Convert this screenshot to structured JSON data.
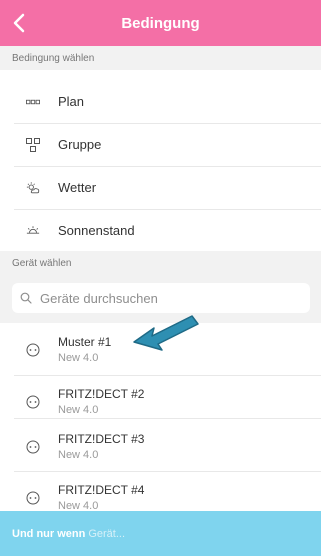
{
  "header": {
    "title": "Bedingung",
    "back_icon": "chevron-left-icon"
  },
  "sections": {
    "condition": "Bedingung wählen",
    "device": "Gerät wählen"
  },
  "conditions": [
    {
      "label": "Plan",
      "icon": "plan-icon"
    },
    {
      "label": "Gruppe",
      "icon": "group-icon"
    },
    {
      "label": "Wetter",
      "icon": "weather-icon"
    },
    {
      "label": "Sonnenstand",
      "icon": "sun-icon"
    }
  ],
  "search": {
    "placeholder": "Geräte durchsuchen",
    "value": ""
  },
  "devices": [
    {
      "name": "Muster #1",
      "sub": "New 4.0"
    },
    {
      "name": "FRITZ!DECT #2",
      "sub": "New 4.0"
    },
    {
      "name": "FRITZ!DECT #3",
      "sub": "New 4.0"
    },
    {
      "name": "FRITZ!DECT #4",
      "sub": "New 4.0"
    }
  ],
  "footer": {
    "bold": "Und nur wenn",
    "light": "Gerät..."
  },
  "colors": {
    "header": "#f46fa6",
    "footer": "#7fd4ee",
    "arrow": "#2e8fb2"
  }
}
